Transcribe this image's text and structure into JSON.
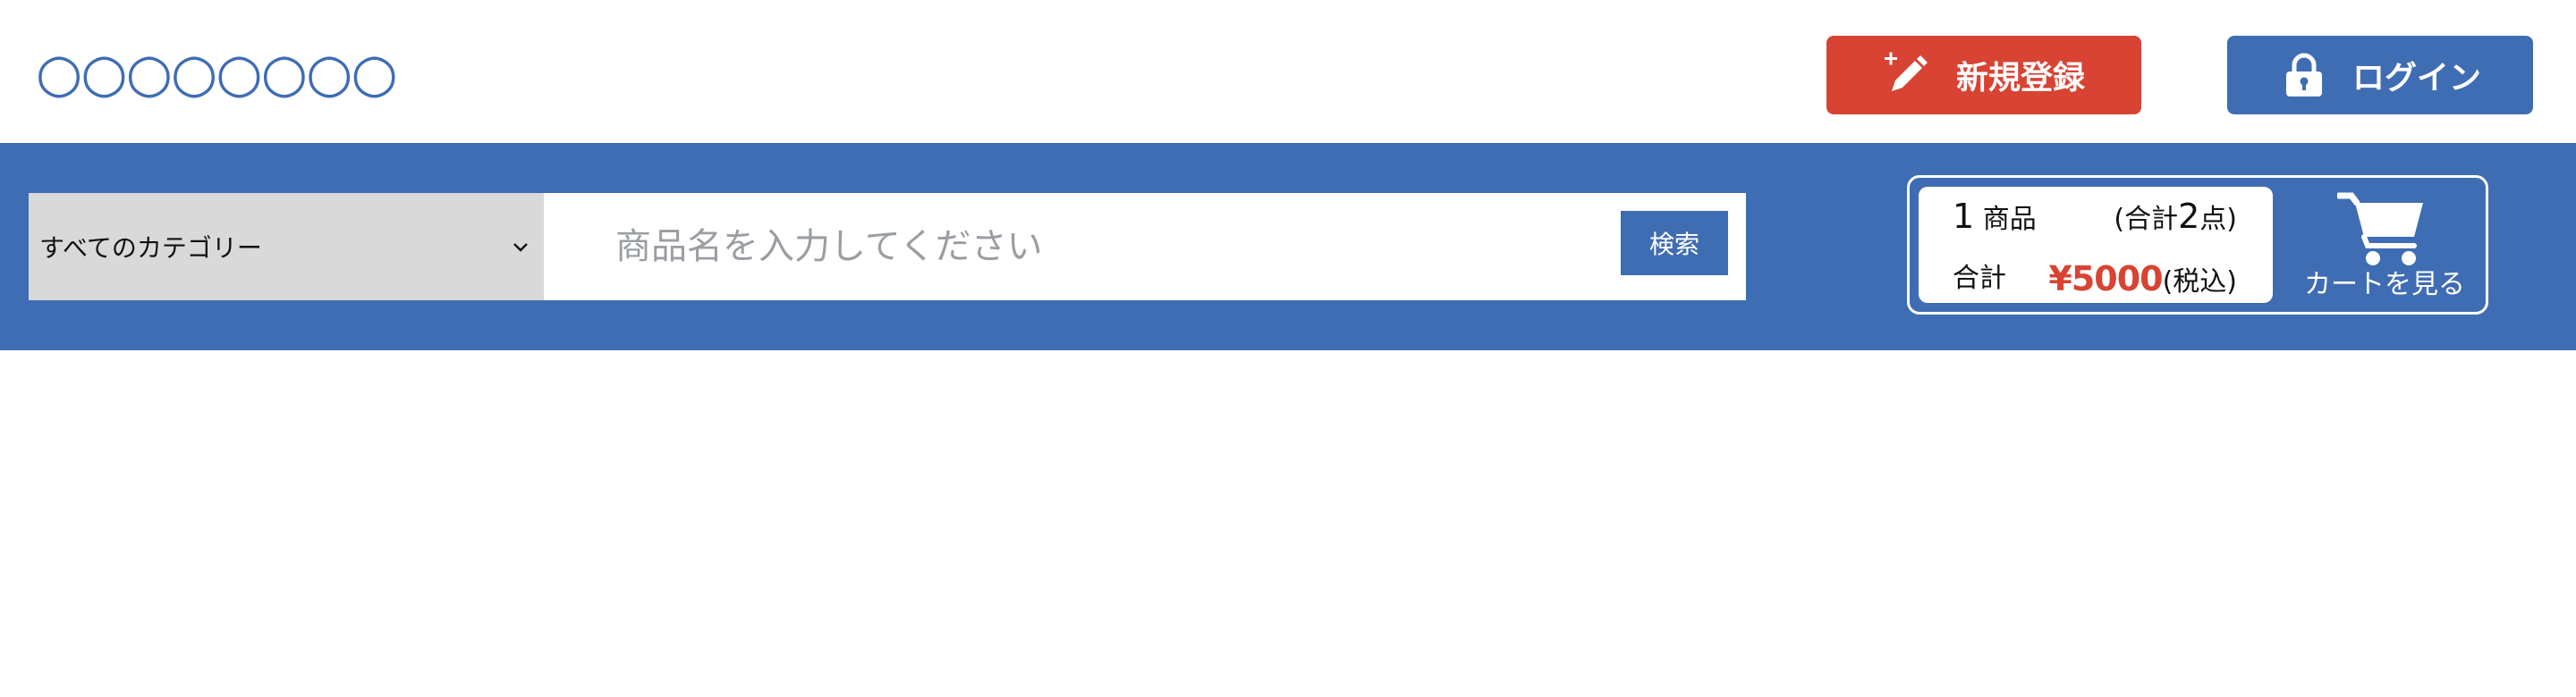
{
  "header": {
    "logo_text": "○○○○○○○○",
    "register_label": "新規登録",
    "login_label": "ログイン"
  },
  "icons": {
    "register": "pencil-sparkle-icon",
    "login": "lock-icon",
    "category_chevron": "chevron-down-icon",
    "cart": "shopping-cart-icon"
  },
  "search": {
    "category_selected": "すべてのカテゴリー",
    "placeholder": "商品名を入力してください",
    "value": "",
    "button_label": "検索"
  },
  "cart": {
    "item_count_number": "1",
    "item_count_unit": "商品",
    "total_qty_prefix": "(合計",
    "total_qty_number": "2",
    "total_qty_suffix": "点)",
    "total_label": "合計",
    "total_price": "¥5000",
    "tax_note": "(税込)",
    "view_label": "カートを見る"
  },
  "colors": {
    "primary_blue": "#3f6db3",
    "register_red": "#d84333",
    "price_red": "#d84333",
    "category_gray": "#d9d9d9"
  }
}
